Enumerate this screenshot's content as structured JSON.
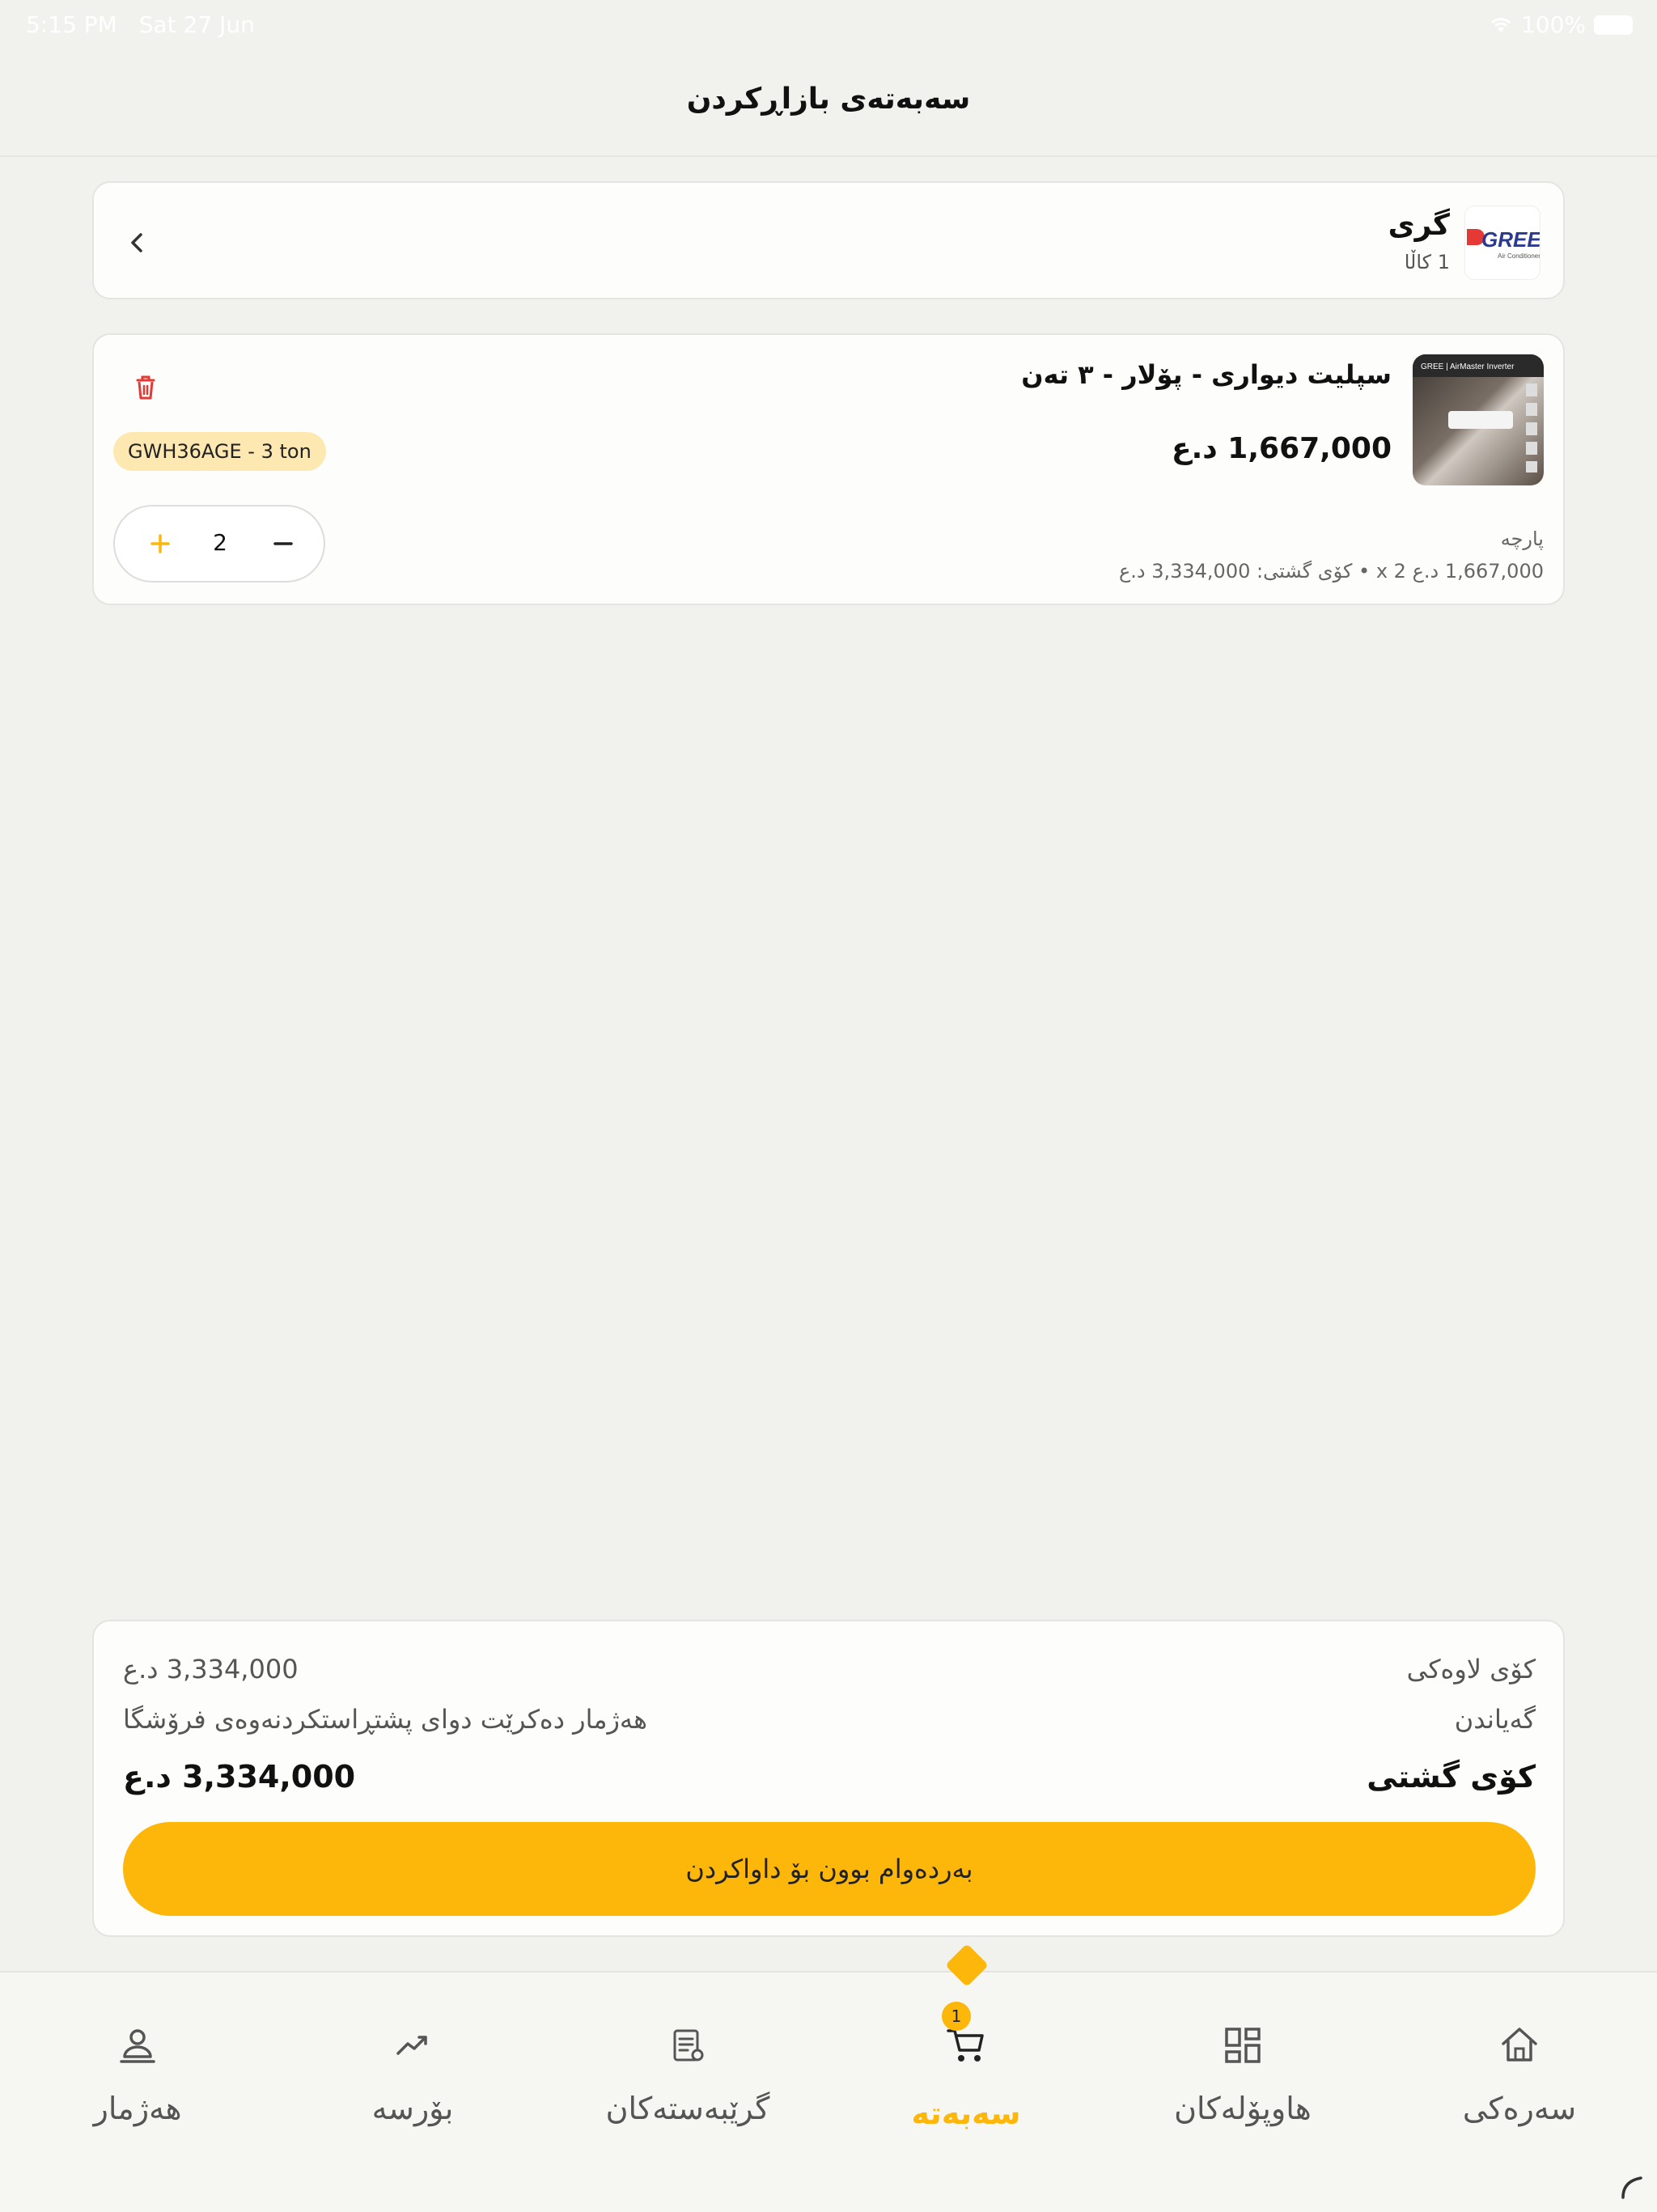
{
  "status": {
    "time": "5:15 PM",
    "date": "Sat 27 Jun",
    "battery": "100%"
  },
  "header": {
    "title": "سەبەتەی بازاڕکردن"
  },
  "vendor": {
    "name": "گری",
    "count": "1 کاڵا",
    "logo_text": "GREE",
    "logo_sub": "Air Conditioners"
  },
  "item": {
    "title": "سپلیت دیواری - پۆلار - ٣ تەن",
    "price": "1,667,000 د.ع",
    "variant": "GWH36AGE - 3 ton",
    "quantity": "2",
    "unit_label": "پارچە",
    "unit_calc": "1,667,000 د.ع x 2  •  کۆی گشتی: 3,334,000 د.ع",
    "thumb_text": "GREE | AirMaster Inverter"
  },
  "summary": {
    "subtotal_label": "کۆی لاوەکی",
    "subtotal_value": "3,334,000 د.ع",
    "delivery_label": "گەیاندن",
    "delivery_value": "هەژمار دەکرێت دوای پشتڕاستکردنەوەی فرۆشگا",
    "total_label": "کۆی گشتی",
    "total_value": "3,334,000 د.ع",
    "checkout_label": "بەردەوام بوون بۆ داواکردن"
  },
  "nav": {
    "account": "هەژمار",
    "exchange": "بۆرسە",
    "contractors": "گرێبەستەکان",
    "cart": "سەبەتە",
    "cart_badge": "1",
    "categories": "هاوپۆلەکان",
    "home": "سەرەکی"
  },
  "colors": {
    "accent": "#fdb70b",
    "danger": "#e53935",
    "variant_bg": "#fde8b2"
  }
}
